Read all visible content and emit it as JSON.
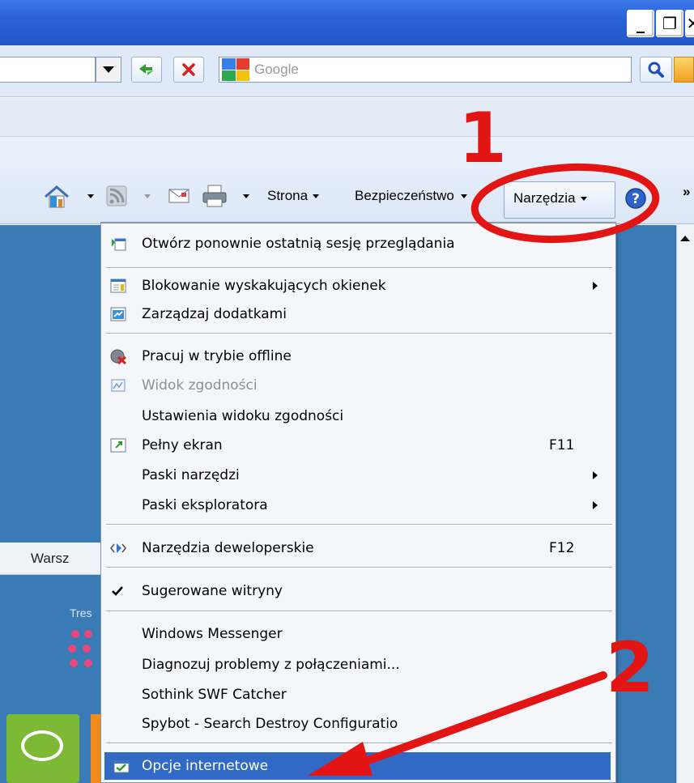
{
  "window": {
    "buttons": {
      "minimize": "_",
      "restore": "❐",
      "close": "✕"
    }
  },
  "search": {
    "placeholder": "Google"
  },
  "command_bar": {
    "strona": "Strona",
    "bezpieczenstwo": "Bezpieczeństwo",
    "narzedzia": "Narzędzia",
    "more": "»"
  },
  "page": {
    "tab_label": "Warsz",
    "tres_label": "Tres"
  },
  "menu": {
    "items": [
      {
        "label": "Otwórz ponownie ostatnią sesję przeglądania",
        "icon": "reopen-session-icon"
      },
      {
        "label": "Blokowanie wyskakujących okienek",
        "icon": "popup-blocker-icon",
        "submenu": true
      },
      {
        "label": "Zarządzaj dodatkami",
        "icon": "addons-icon"
      },
      {
        "label": "Pracuj w trybie offline",
        "icon": "offline-icon"
      },
      {
        "label": "Widok zgodności",
        "icon": "compatibility-view-icon",
        "disabled": true
      },
      {
        "label": "Ustawienia widoku zgodności"
      },
      {
        "label": "Pełny ekran",
        "icon": "fullscreen-icon",
        "shortcut": "F11"
      },
      {
        "label": "Paski narzędzi",
        "submenu": true
      },
      {
        "label": "Paski eksploratora",
        "submenu": true
      },
      {
        "label": "Narzędzia deweloperskie",
        "icon": "developer-tools-icon",
        "shortcut": "F12"
      },
      {
        "label": "Sugerowane witryny",
        "icon": "checkmark-icon"
      },
      {
        "label": "Windows Messenger"
      },
      {
        "label": "Diagnozuj problemy z połączeniami..."
      },
      {
        "label": "Sothink SWF Catcher"
      },
      {
        "label": "Spybot - Search  Destroy Configuratio"
      },
      {
        "label": "Opcje internetowe",
        "icon": "internet-options-icon",
        "highlighted": true
      }
    ]
  },
  "annotations": {
    "step1": "1",
    "step2": "2"
  },
  "colors": {
    "titlebar": "#2b62d6",
    "menu_highlight": "#316ac5",
    "annotation_red": "#e31414",
    "page_background": "#3a7ab5"
  }
}
